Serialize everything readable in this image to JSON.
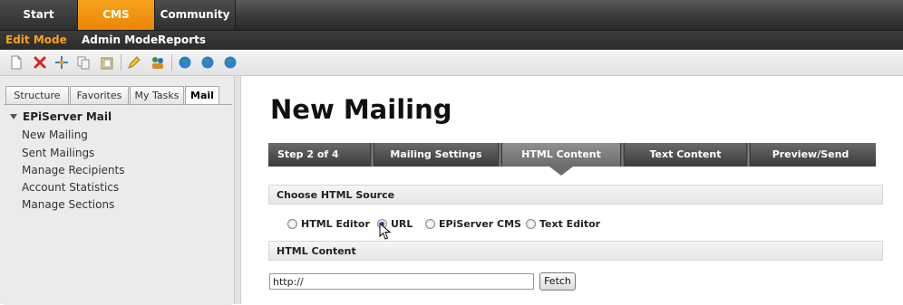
{
  "top_tabs": [
    {
      "label": "Start",
      "active": false
    },
    {
      "label": "CMS",
      "active": true
    },
    {
      "label": "Community",
      "active": false
    }
  ],
  "modes": [
    {
      "label": "Edit Mode",
      "active": true
    },
    {
      "label": "Admin Mode",
      "active": false
    },
    {
      "label": "Reports",
      "active": false
    }
  ],
  "toolbar": {
    "icons": [
      "new-page-icon",
      "delete-icon",
      "move-icon",
      "copy-icon",
      "paste-icon",
      "edit-icon",
      "users-icon",
      "globe-icon",
      "globe-back-icon",
      "globe-forward-icon"
    ]
  },
  "left_tabs": [
    {
      "label": "Structure",
      "active": false
    },
    {
      "label": "Favorites",
      "active": false
    },
    {
      "label": "My Tasks",
      "active": false
    },
    {
      "label": "Mail",
      "active": true
    }
  ],
  "tree": {
    "root": "EPiServer Mail",
    "items": [
      "New Mailing",
      "Sent Mailings",
      "Manage Recipients",
      "Account Statistics",
      "Manage Sections"
    ]
  },
  "main": {
    "title": "New Mailing",
    "steps": [
      {
        "label": "Step 2 of 4",
        "active": false
      },
      {
        "label": "Mailing Settings",
        "active": false
      },
      {
        "label": "HTML Content",
        "active": true
      },
      {
        "label": "Text Content",
        "active": false
      },
      {
        "label": "Preview/Send",
        "active": false
      }
    ],
    "source_heading": "Choose HTML Source",
    "source_options": [
      {
        "label": "HTML Editor",
        "checked": false
      },
      {
        "label": "URL",
        "checked": true
      },
      {
        "label": "EPiServer CMS",
        "checked": false
      },
      {
        "label": "Text Editor",
        "checked": false
      }
    ],
    "content_heading": "HTML Content",
    "url_value": "http://",
    "fetch_label": "Fetch"
  },
  "colors": {
    "accent": "#f39c12",
    "dark_bar": "#2f2f2f"
  }
}
